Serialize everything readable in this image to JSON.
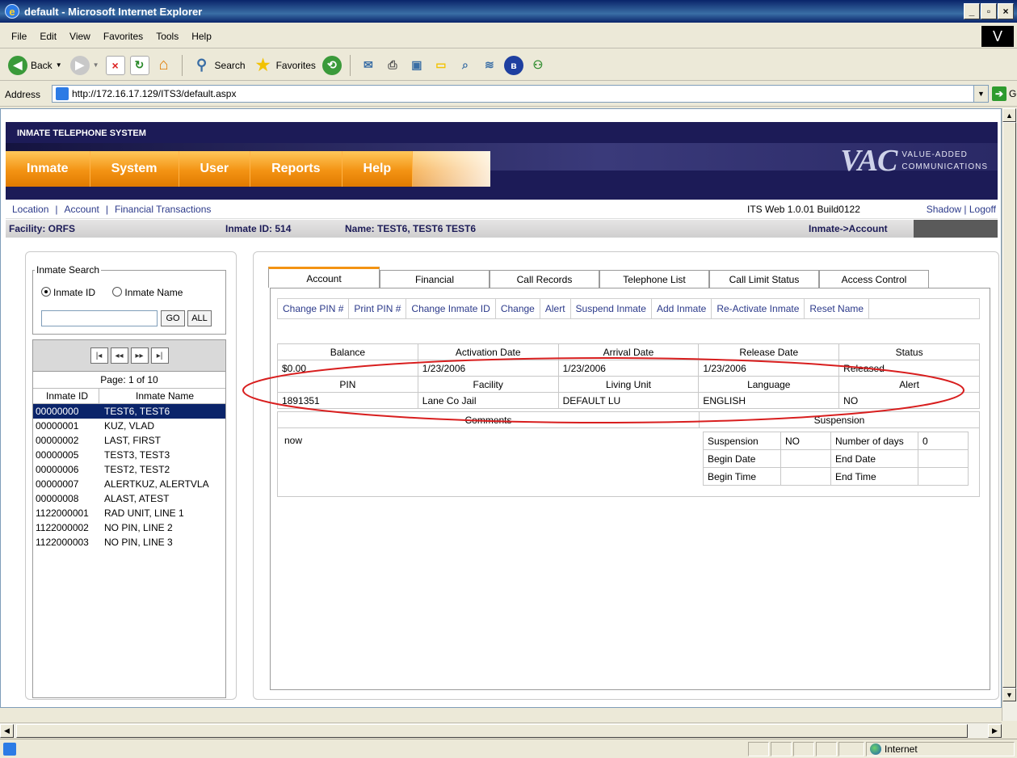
{
  "window": {
    "title": "default - Microsoft Internet Explorer",
    "buttons": [
      "_",
      "▫",
      "×"
    ]
  },
  "menubar": {
    "items": [
      "File",
      "Edit",
      "View",
      "Favorites",
      "Tools",
      "Help"
    ],
    "windows_logo": "V"
  },
  "toolbar": {
    "back_label": "Back",
    "search_label": "Search",
    "favorites_label": "Favorites"
  },
  "addressbar": {
    "label": "Address",
    "url": "http://172.16.17.129/ITS3/default.aspx",
    "go_label": "Go"
  },
  "statusbar": {
    "zone": "Internet"
  },
  "app": {
    "system_name": "INMATE TELEPHONE SYSTEM",
    "nav": [
      "Inmate",
      "System",
      "User",
      "Reports",
      "Help"
    ],
    "logo": {
      "mark": "VAC",
      "line1": "VALUE-ADDED",
      "line2": "COMMUNICATIONS"
    },
    "subnav": [
      "Location",
      "Account",
      "Financial Transactions"
    ],
    "build": "ITS Web 1.0.01 Build0122",
    "right_links": "Shadow | Logoff",
    "facility": "Facility: ORFS",
    "inmate_id": "Inmate ID: 514",
    "name": "Name: TEST6, TEST6 TEST6",
    "crumb": "Inmate->Account"
  },
  "search": {
    "legend": "Inmate Search",
    "option_id": "Inmate ID",
    "option_name": "Inmate Name",
    "selected": "Inmate ID",
    "input_value": "",
    "go_label": "GO",
    "all_label": "ALL",
    "pager": [
      "|◂",
      "◂◂",
      "▸▸",
      "▸|"
    ],
    "page_info": "Page: 1 of 10",
    "columns": [
      "Inmate ID",
      "Inmate Name"
    ],
    "rows": [
      {
        "id": "00000000",
        "name": "TEST6, TEST6"
      },
      {
        "id": "00000001",
        "name": "KUZ, VLAD"
      },
      {
        "id": "00000002",
        "name": "LAST, FIRST"
      },
      {
        "id": "00000005",
        "name": "TEST3, TEST3"
      },
      {
        "id": "00000006",
        "name": "TEST2, TEST2"
      },
      {
        "id": "00000007",
        "name": "ALERTKUZ, ALERTVLA"
      },
      {
        "id": "00000008",
        "name": "ALAST, ATEST"
      },
      {
        "id": "1122000001",
        "name": "RAD UNIT, LINE 1"
      },
      {
        "id": "1122000002",
        "name": "NO PIN, LINE 2"
      },
      {
        "id": "1122000003",
        "name": "NO PIN, LINE 3"
      }
    ]
  },
  "tabs": [
    "Account",
    "Financial",
    "Call Records",
    "Telephone List",
    "Call Limit Status",
    "Access Control"
  ],
  "actions": [
    "Change PIN #",
    "Print PIN #",
    "Change Inmate ID",
    "Change",
    "Alert",
    "Suspend Inmate",
    "Add Inmate",
    "Re-Activate Inmate",
    "Reset Name"
  ],
  "account": {
    "head1": [
      "Balance",
      "Activation Date",
      "Arrival Date",
      "Release Date",
      "Status"
    ],
    "row1": [
      "$0.00",
      "1/23/2006",
      "1/23/2006",
      "1/23/2006",
      "Released"
    ],
    "head2": [
      "PIN",
      "Facility",
      "Living Unit",
      "Language",
      "Alert"
    ],
    "row2": [
      "1891351",
      "Lane Co Jail",
      "DEFAULT LU",
      "ENGLISH",
      "NO"
    ]
  },
  "comments": {
    "header": "Comments",
    "text": "now"
  },
  "suspension": {
    "header": "Suspension",
    "suspension_label": "Suspension",
    "suspension_value": "NO",
    "days_label": "Number of days",
    "days_value": "0",
    "begin_date_label": "Begin Date",
    "begin_date_value": "",
    "end_date_label": "End Date",
    "end_date_value": "",
    "begin_time_label": "Begin Time",
    "begin_time_value": "",
    "end_time_label": "End Time",
    "end_time_value": ""
  }
}
